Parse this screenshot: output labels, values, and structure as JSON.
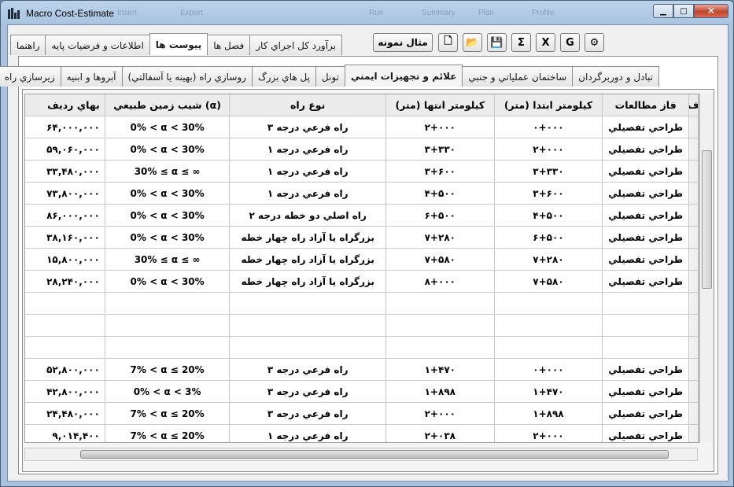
{
  "window": {
    "title": "Macro Cost-Estimate"
  },
  "background_ghost": [
    "Insert",
    "Export",
    "Run",
    "Summary",
    "Plan",
    "Profile"
  ],
  "outer_tabs": [
    {
      "label": "برآورد کل اجراي کار",
      "active": false
    },
    {
      "label": "فصل ها",
      "active": false
    },
    {
      "label": "پيوست ها",
      "active": true
    },
    {
      "label": "اطلاعات و فرضيات پايه",
      "active": false
    },
    {
      "label": "راهنما",
      "active": false
    }
  ],
  "sample_button": "مثال نمونه",
  "toolbar": [
    {
      "name": "new-file-icon",
      "glyph": "🗋"
    },
    {
      "name": "open-folder-icon",
      "glyph": "📂"
    },
    {
      "name": "save-icon",
      "glyph": "💾"
    },
    {
      "name": "sum-icon",
      "glyph": "Σ"
    },
    {
      "name": "excel-icon",
      "glyph": "X"
    },
    {
      "name": "google-icon",
      "glyph": "G"
    },
    {
      "name": "settings-icon",
      "glyph": "⚙"
    }
  ],
  "inner_tabs": [
    {
      "label": "تبادل و دوربرگردان",
      "active": false
    },
    {
      "label": "ساختمان عملياتي و جنبي",
      "active": false
    },
    {
      "label": "علائم و تجهيزات ايمني",
      "active": true
    },
    {
      "label": "تونل",
      "active": false
    },
    {
      "label": "پل هاي بزرگ",
      "active": false
    },
    {
      "label": "روسازي راه (بهينه يا آسفالتي)",
      "active": false
    },
    {
      "label": "آبروها و ابنيه",
      "active": false
    },
    {
      "label": "زيرسازي راه",
      "active": false
    }
  ],
  "grid": {
    "columns": [
      "ف",
      "فاز مطالعات",
      "کيلومتر ابتدا (متر)",
      "کيلومتر انتها (متر)",
      "نوع راه",
      "شيب زمين طبيعي (α)",
      "بهاي رديف"
    ],
    "rows": [
      [
        "",
        "طراحي تفصيلي",
        "۰+۰۰۰",
        "۲+۰۰۰",
        "راه فرعي درجه ۳",
        "0% < α < 30%",
        "۶۴,۰۰۰,۰۰۰"
      ],
      [
        "",
        "طراحي تفصيلي",
        "۲+۰۰۰",
        "۳+۳۳۰",
        "راه فرعي درجه ۱",
        "0% < α < 30%",
        "۵۹,۰۶۰,۰۰۰"
      ],
      [
        "",
        "طراحي تفصيلي",
        "۳+۳۳۰",
        "۳+۶۰۰",
        "راه فرعي درجه ۱",
        "30% ≤ α ≤ ∞",
        "۳۳,۴۸۰,۰۰۰"
      ],
      [
        "",
        "طراحي تفصيلي",
        "۳+۶۰۰",
        "۴+۵۰۰",
        "راه فرعي درجه ۱",
        "0% < α < 30%",
        "۷۳,۸۰۰,۰۰۰"
      ],
      [
        "",
        "طراحي تفصيلي",
        "۴+۵۰۰",
        "۶+۵۰۰",
        "راه اصلي دو خطه درجه ۲",
        "0% < α < 30%",
        "۸۶,۰۰۰,۰۰۰"
      ],
      [
        "",
        "طراحي تفصيلي",
        "۶+۵۰۰",
        "۷+۲۸۰",
        "بزرگراه يا آزاد راه چهار خطه",
        "0% < α < 30%",
        "۳۸,۱۶۰,۰۰۰"
      ],
      [
        "",
        "طراحي تفصيلي",
        "۷+۲۸۰",
        "۷+۵۸۰",
        "بزرگراه يا آزاد راه چهار خطه",
        "30% ≤ α ≤ ∞",
        "۱۵,۸۰۰,۰۰۰"
      ],
      [
        "",
        "طراحي تفصيلي",
        "۷+۵۸۰",
        "۸+۰۰۰",
        "بزرگراه يا آزاد راه چهار خطه",
        "0% < α < 30%",
        "۲۸,۲۴۰,۰۰۰"
      ],
      [
        "",
        "",
        "",
        "",
        "",
        "",
        ""
      ],
      [
        "",
        "",
        "",
        "",
        "",
        "",
        ""
      ],
      [
        "",
        "",
        "",
        "",
        "",
        "",
        ""
      ],
      [
        "",
        "طراحي تفصيلي",
        "۰+۰۰۰",
        "۱+۴۷۰",
        "راه فرعي درجه ۳",
        "7% < α ≤ 20%",
        "۵۲,۸۰۰,۰۰۰"
      ],
      [
        "",
        "طراحي تفصيلي",
        "۱+۴۷۰",
        "۱+۸۹۸",
        "راه فرعي درجه ۳",
        "0% < α < 3%",
        "۴۲,۸۰۰,۰۰۰"
      ],
      [
        "",
        "طراحي تفصيلي",
        "۱+۸۹۸",
        "۲+۰۰۰",
        "راه فرعي درجه ۳",
        "7% < α ≤ 20%",
        "۲۴,۴۸۰,۰۰۰"
      ],
      [
        "",
        "طراحي تفصيلي",
        "۲+۰۰۰",
        "۲+۰۳۸",
        "راه فرعي درجه ۱",
        "7% < α ≤ 20%",
        "۹,۰۱۴,۴۰۰"
      ]
    ]
  }
}
